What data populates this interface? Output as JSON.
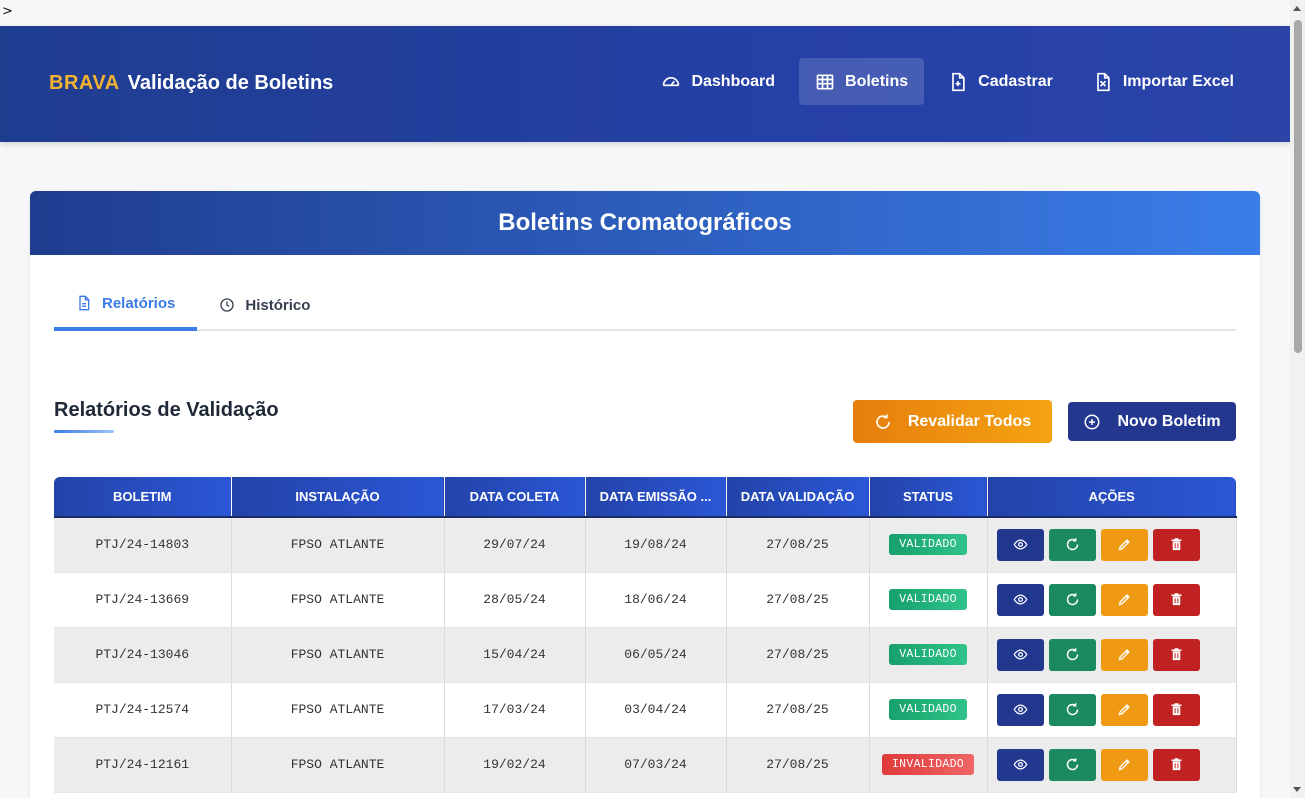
{
  "caret": ">",
  "navbar": {
    "brand_accent": "BRAVA",
    "brand_title": "Validação de Boletins",
    "items": [
      {
        "label": "Dashboard",
        "icon": "gauge-icon"
      },
      {
        "label": "Boletins",
        "icon": "table-icon",
        "active": true
      },
      {
        "label": "Cadastrar",
        "icon": "file-plus-icon"
      },
      {
        "label": "Importar Excel",
        "icon": "file-excel-icon"
      }
    ]
  },
  "card": {
    "title": "Boletins Cromatográficos",
    "tabs": [
      {
        "label": "Relatórios",
        "icon": "document-icon",
        "active": true
      },
      {
        "label": "Histórico",
        "icon": "clock-icon"
      }
    ],
    "section_title": "Relatórios de Validação",
    "buttons": {
      "revalidate_all": "Revalidar Todos",
      "new_boletim": "Novo Boletim"
    },
    "table": {
      "headers": [
        "BOLETIM",
        "INSTALAÇÃO",
        "DATA COLETA",
        "DATA EMISSÃO ...",
        "DATA VALIDAÇÃO",
        "STATUS",
        "AÇÕES"
      ],
      "rows": [
        {
          "boletim": "PTJ/24-14803",
          "instalacao": "FPSO ATLANTE",
          "data_coleta": "29/07/24",
          "data_emissao": "19/08/24",
          "data_validacao": "27/08/25",
          "status": "VALIDADO"
        },
        {
          "boletim": "PTJ/24-13669",
          "instalacao": "FPSO ATLANTE",
          "data_coleta": "28/05/24",
          "data_emissao": "18/06/24",
          "data_validacao": "27/08/25",
          "status": "VALIDADO"
        },
        {
          "boletim": "PTJ/24-13046",
          "instalacao": "FPSO ATLANTE",
          "data_coleta": "15/04/24",
          "data_emissao": "06/05/24",
          "data_validacao": "27/08/25",
          "status": "VALIDADO"
        },
        {
          "boletim": "PTJ/24-12574",
          "instalacao": "FPSO ATLANTE",
          "data_coleta": "17/03/24",
          "data_emissao": "03/04/24",
          "data_validacao": "27/08/25",
          "status": "VALIDADO"
        },
        {
          "boletim": "PTJ/24-12161",
          "instalacao": "FPSO ATLANTE",
          "data_coleta": "19/02/24",
          "data_emissao": "07/03/24",
          "data_validacao": "27/08/25",
          "status": "INVALIDADO"
        }
      ],
      "action_icons": [
        "eye-icon",
        "refresh-icon",
        "pencil-icon",
        "trash-icon"
      ]
    }
  },
  "colors": {
    "navbar": "#1f3d8f",
    "brand_accent": "#f3b22f",
    "tab_active": "#3b7be5",
    "status_valid": "#17a06b",
    "status_invalid": "#e03a3a"
  }
}
